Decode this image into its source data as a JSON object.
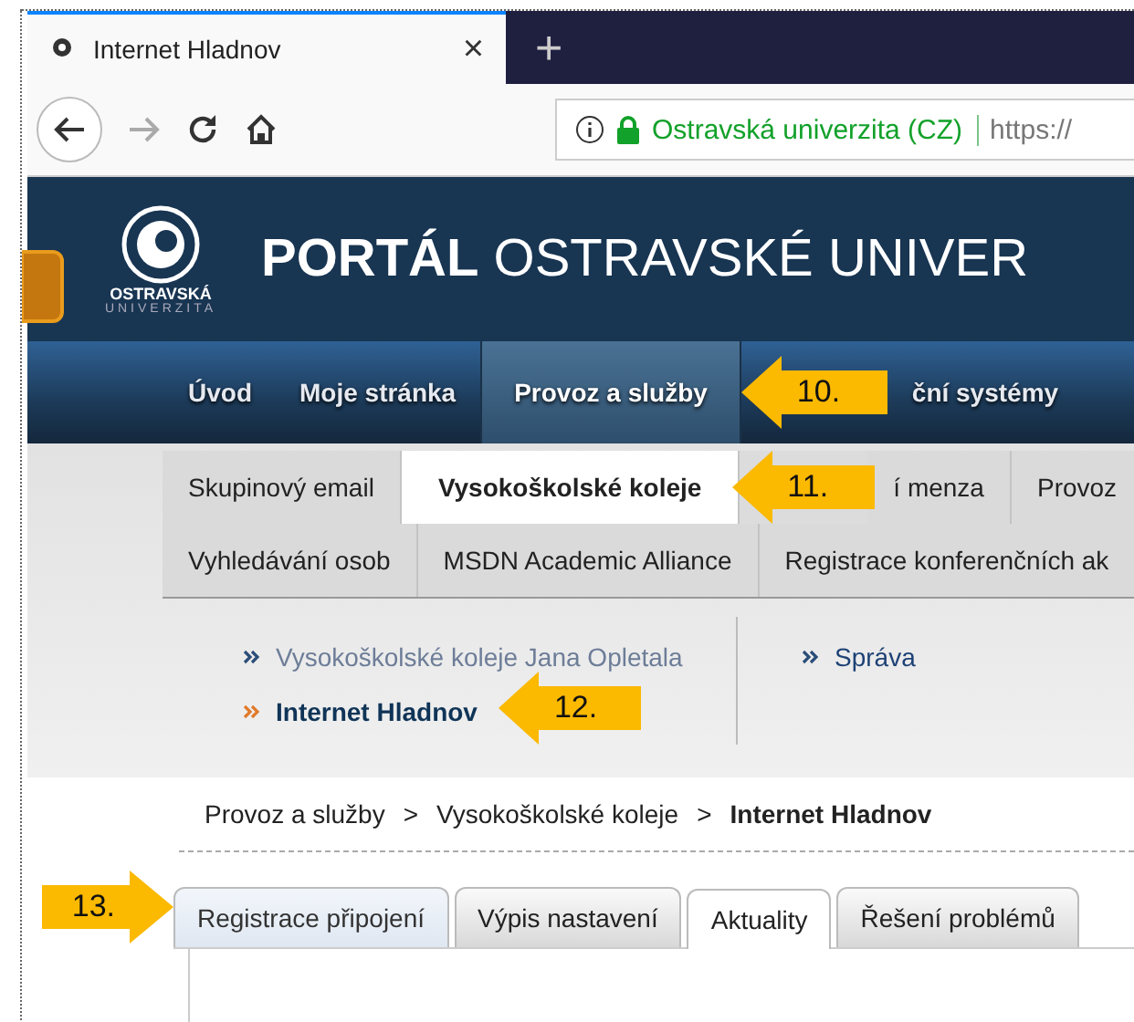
{
  "browser": {
    "tab_title": "Internet Hladnov",
    "close": "×",
    "new_tab": "+",
    "site_identity": "Ostravská univerzita (CZ)",
    "url": "https://"
  },
  "header": {
    "logo_line1": "OSTRAVSKÁ",
    "logo_line2": "UNIVERZITA",
    "title_bold": "PORTÁL",
    "title_rest": "OSTRAVSKÉ UNIVER"
  },
  "nav": [
    {
      "kind": "item",
      "label": "Úvod",
      "selected": false
    },
    {
      "kind": "item",
      "label": "Moje stránka",
      "selected": false
    },
    {
      "kind": "item",
      "label": "Provoz a služby",
      "selected": true
    },
    {
      "kind": "callout",
      "label": "10."
    },
    {
      "kind": "item",
      "label": "ční systémy",
      "selected": false
    }
  ],
  "service_tabs": [
    [
      {
        "kind": "item",
        "label": "Skupinový email",
        "selected": false
      },
      {
        "kind": "item",
        "label": "Vysokoškolské koleje",
        "selected": true
      },
      {
        "kind": "callout",
        "label": "11."
      },
      {
        "kind": "item",
        "label": "í menza",
        "selected": false
      },
      {
        "kind": "item",
        "label": "Provoz",
        "selected": false
      }
    ],
    [
      {
        "kind": "item",
        "label": "Vyhledávání osob",
        "selected": false
      },
      {
        "kind": "item",
        "label": "MSDN Academic Alliance",
        "selected": false
      },
      {
        "kind": "item",
        "label": "Registrace konferenčních ak",
        "selected": false
      }
    ]
  ],
  "submenu": {
    "left": [
      {
        "kind": "item",
        "label": "Vysokoškolské koleje Jana Opletala",
        "selected": false
      },
      {
        "kind": "item",
        "label": "Internet Hladnov",
        "selected": true
      },
      {
        "kind": "callout",
        "label": "12."
      }
    ],
    "right": [
      {
        "kind": "item",
        "label": "Správa",
        "selected": false
      }
    ]
  },
  "breadcrumb": {
    "items": [
      "Provoz a služby",
      "Vysokoškolské koleje",
      "Internet Hladnov"
    ],
    "separator": ">"
  },
  "content_tabs": {
    "callout": "13.",
    "tabs": [
      {
        "label": "Registrace připojení",
        "selected": false,
        "highlighted": true
      },
      {
        "label": "Výpis nastavení",
        "selected": false,
        "highlighted": false
      },
      {
        "label": "Aktuality",
        "selected": true,
        "highlighted": false
      },
      {
        "label": "Řešení problémů",
        "selected": false,
        "highlighted": false
      }
    ]
  }
}
